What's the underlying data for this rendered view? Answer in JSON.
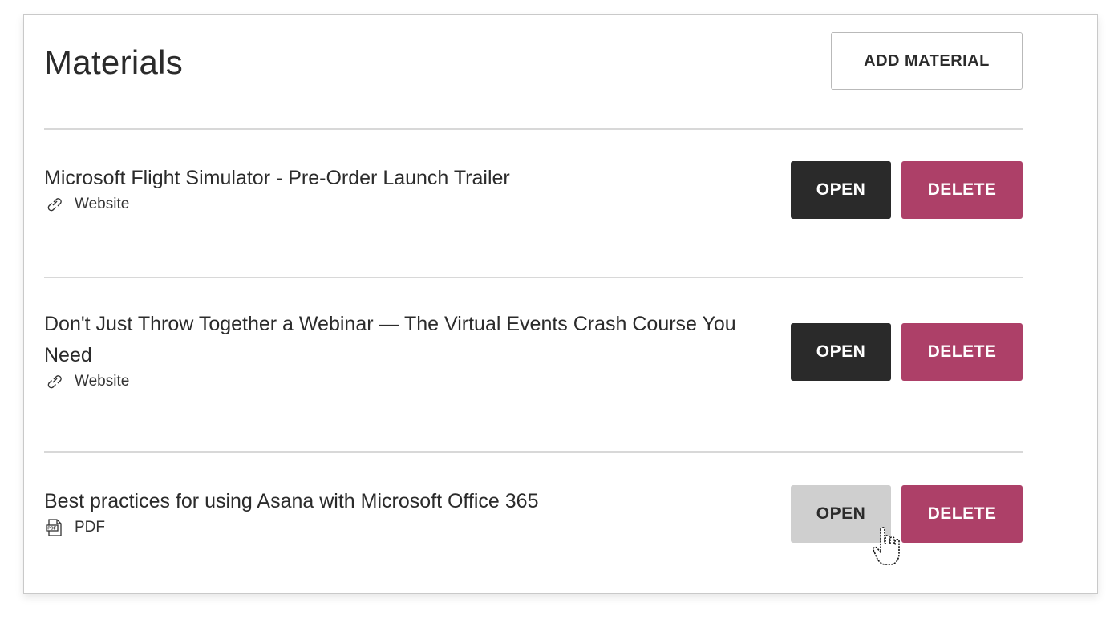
{
  "header": {
    "title": "Materials",
    "add_label": "ADD MATERIAL"
  },
  "materials": [
    {
      "title": "Microsoft Flight Simulator - Pre-Order Launch Trailer",
      "type_label": "Website",
      "type_icon": "link-icon",
      "open_label": "OPEN",
      "delete_label": "DELETE",
      "open_state": "normal"
    },
    {
      "title": "Don't Just Throw Together a Webinar — The Virtual Events Crash Course You Need",
      "type_label": "Website",
      "type_icon": "link-icon",
      "open_label": "OPEN",
      "delete_label": "DELETE",
      "open_state": "normal"
    },
    {
      "title": "Best practices for using Asana with Microsoft Office 365",
      "type_label": "PDF",
      "type_icon": "pdf-file-icon",
      "open_label": "OPEN",
      "delete_label": "DELETE",
      "open_state": "hover"
    }
  ],
  "colors": {
    "open_button": "#2a2a2a",
    "open_button_hover": "#cfcfcf",
    "delete_button": "#ad4068",
    "divider": "#d8d8d8"
  }
}
